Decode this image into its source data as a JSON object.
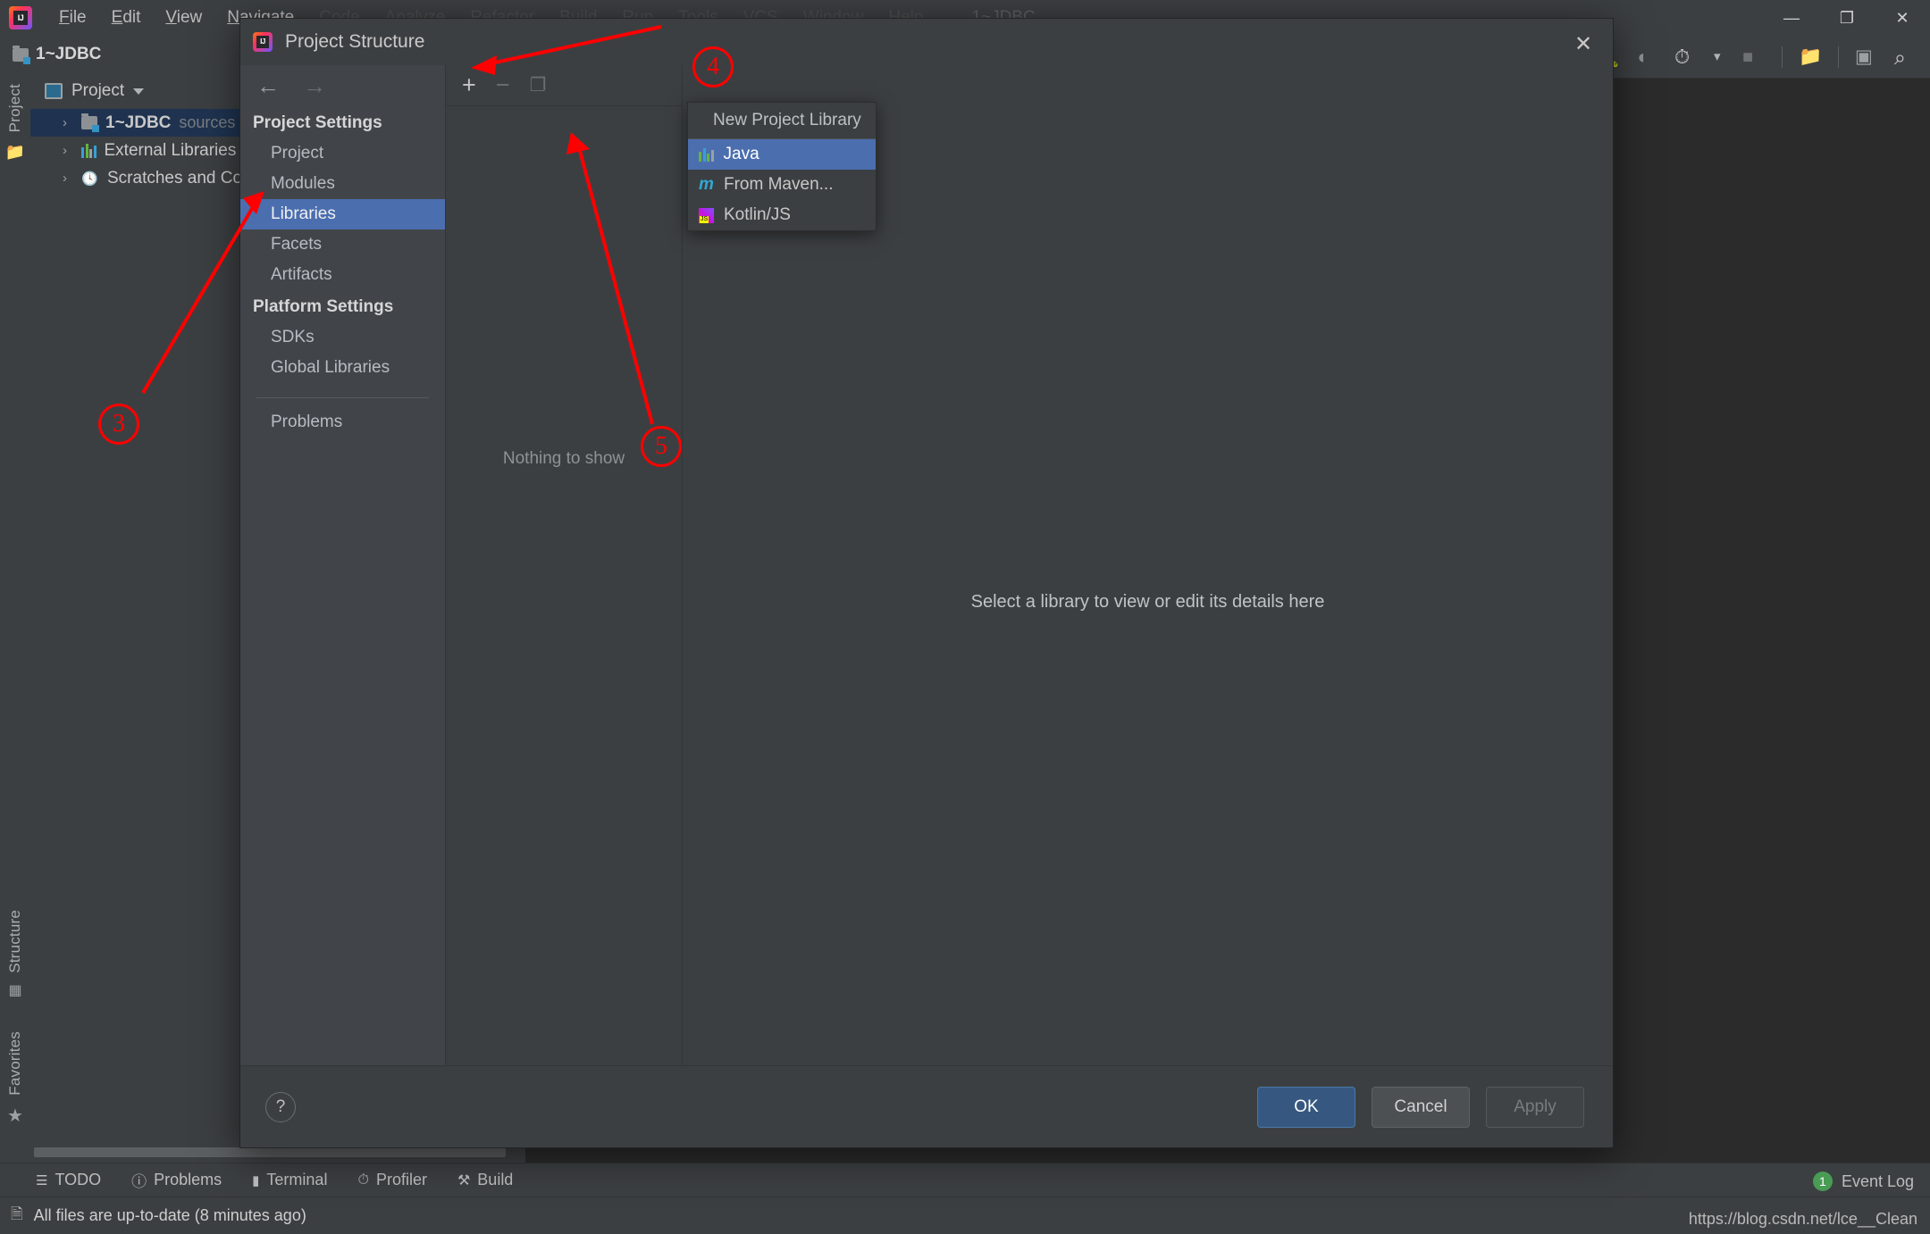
{
  "app": {
    "logo_icon": "intellij-idea-logo",
    "menu_items": [
      {
        "label": "File",
        "mnemonic": "F",
        "faded": false
      },
      {
        "label": "Edit",
        "mnemonic": "E",
        "faded": false
      },
      {
        "label": "View",
        "mnemonic": "V",
        "faded": false
      },
      {
        "label": "Navigate",
        "mnemonic": "N",
        "faded": false
      },
      {
        "label": "Code",
        "mnemonic": "C",
        "faded": true
      },
      {
        "label": "Analyze",
        "mnemonic": "A",
        "faded": true
      },
      {
        "label": "Refactor",
        "mnemonic": "R",
        "faded": true
      },
      {
        "label": "Build",
        "mnemonic": "B",
        "faded": true
      },
      {
        "label": "Run",
        "mnemonic": "u",
        "faded": true
      },
      {
        "label": "Tools",
        "mnemonic": "T",
        "faded": true
      },
      {
        "label": "VCS",
        "mnemonic": "S",
        "faded": true
      },
      {
        "label": "Window",
        "mnemonic": "W",
        "faded": true
      },
      {
        "label": "Help",
        "mnemonic": "H",
        "faded": true
      }
    ],
    "project_label": "1~JDBC",
    "window_controls": [
      {
        "name": "minimize-button",
        "glyph": "—"
      },
      {
        "name": "maximize-button",
        "glyph": "❐"
      },
      {
        "name": "close-button",
        "glyph": "✕"
      }
    ],
    "run_toolbar": [
      {
        "name": "run-button",
        "glyph": "▶",
        "color": "#59a869"
      },
      {
        "name": "debug-button",
        "glyph": "⚿",
        "color": "#59a869"
      },
      {
        "name": "run-with-coverage-button",
        "glyph": "◗",
        "color": "#59a869"
      },
      {
        "name": "profiler-button",
        "glyph": "◴",
        "color": "#cfcfcf"
      },
      {
        "name": "dropdown-arrow-icon",
        "glyph": "▾",
        "color": "#b0b4b7"
      },
      {
        "name": "stop-button",
        "glyph": "■",
        "color": "#6e7174"
      },
      {
        "name": "project-structure-button",
        "glyph": "▥",
        "color": "#9aa0a3"
      },
      {
        "name": "terminal-button",
        "glyph": "▷",
        "color": "#59a869"
      },
      {
        "name": "search-everywhere-button",
        "glyph": "⌕",
        "color": "#cfcfcf"
      }
    ]
  },
  "project_panel": {
    "header_label": "Project",
    "tree": [
      {
        "label": "1~JDBC",
        "suffix": "sources root",
        "icon": "module-folder-icon",
        "selected": true,
        "bold": true
      },
      {
        "label": "External Libraries",
        "suffix": "",
        "icon": "library-icon",
        "selected": false,
        "bold": false
      },
      {
        "label": "Scratches and Consoles",
        "suffix": "",
        "icon": "scratches-icon",
        "selected": false,
        "bold": false
      }
    ]
  },
  "tool_strips": {
    "left_top": "Project",
    "left_bottom": [
      "Structure",
      "Favorites"
    ]
  },
  "dialog": {
    "title": "Project Structure",
    "logo_icon": "intellij-idea-logo",
    "close_glyph": "✕",
    "nav": {
      "back_glyph": "←",
      "forward_glyph": "→",
      "project_settings_header": "Project Settings",
      "project_settings_items": [
        "Project",
        "Modules",
        "Libraries",
        "Facets",
        "Artifacts"
      ],
      "selected_item": "Libraries",
      "platform_settings_header": "Platform Settings",
      "platform_settings_items": [
        "SDKs",
        "Global Libraries"
      ],
      "other_items": [
        "Problems"
      ]
    },
    "toolbar": [
      {
        "name": "add-button",
        "glyph": "+",
        "enabled": true
      },
      {
        "name": "remove-button",
        "glyph": "−",
        "enabled": false
      },
      {
        "name": "copy-button",
        "glyph": "❐",
        "enabled": false
      }
    ],
    "list_empty_text": "Nothing to show",
    "detail_empty_text": "Select a library to view or edit its details here",
    "popup": {
      "header": "New Project Library",
      "items": [
        {
          "label": "Java",
          "icon": "java-library-icon",
          "selected": true
        },
        {
          "label": "From Maven...",
          "icon": "maven-icon",
          "selected": false
        },
        {
          "label": "Kotlin/JS",
          "icon": "kotlin-js-icon",
          "selected": false
        }
      ]
    },
    "footer": {
      "help_glyph": "?",
      "ok_label": "OK",
      "cancel_label": "Cancel",
      "apply_label": "Apply"
    }
  },
  "tool_window_bar": [
    {
      "label": "TODO",
      "icon": "todo-icon"
    },
    {
      "label": "Problems",
      "icon": "problems-icon"
    },
    {
      "label": "Terminal",
      "icon": "terminal-icon"
    },
    {
      "label": "Profiler",
      "icon": "profiler-icon"
    },
    {
      "label": "Build",
      "icon": "build-icon"
    }
  ],
  "event_log": {
    "count": "1",
    "label": "Event Log"
  },
  "status_bar": {
    "icon": "file-icon",
    "message": "All files are up-to-date (8 minutes ago)",
    "watermark": "https://blog.csdn.net/lce__Clean"
  },
  "annotations": {
    "color": "#ff0000",
    "markers": [
      {
        "number": "③",
        "target": "libraries-nav-item"
      },
      {
        "number": "④",
        "target": "add-button"
      },
      {
        "number": "⑤",
        "target": "java-popup-item"
      }
    ],
    "labels": [
      "3",
      "4",
      "5"
    ]
  }
}
